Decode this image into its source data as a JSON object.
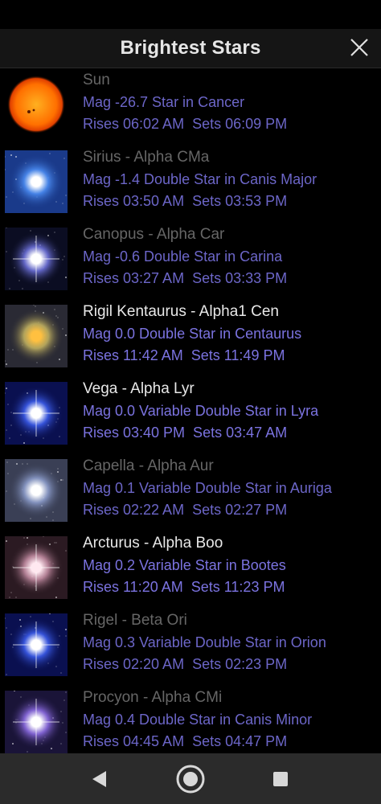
{
  "header": {
    "title": "Brightest Stars",
    "close_icon": "close-icon"
  },
  "stars": [
    {
      "name": "Sun",
      "mag_line": "Mag -26.7 Star in Cancer",
      "rise_line": "Rises 06:02 AM  Sets 06:09 PM",
      "above_horizon": false,
      "image": "sun"
    },
    {
      "name": "Sirius - Alpha CMa",
      "mag_line": "Mag -1.4 Double Star in Canis Major",
      "rise_line": "Rises 03:50 AM  Sets 03:53 PM",
      "above_horizon": false,
      "image": "blue-white-star"
    },
    {
      "name": "Canopus - Alpha Car",
      "mag_line": "Mag -0.6 Double Star in Carina",
      "rise_line": "Rises 03:27 AM  Sets 03:33 PM",
      "above_horizon": false,
      "image": "white-star"
    },
    {
      "name": "Rigil Kentaurus - Alpha1 Cen",
      "mag_line": "Mag 0.0 Double Star in Centaurus",
      "rise_line": "Rises 11:42 AM  Sets 11:49 PM",
      "above_horizon": true,
      "image": "yellow-star"
    },
    {
      "name": "Vega - Alpha Lyr",
      "mag_line": "Mag 0.0 Variable Double Star in Lyra",
      "rise_line": "Rises 03:40 PM  Sets 03:47 AM",
      "above_horizon": true,
      "image": "blue-star"
    },
    {
      "name": "Capella - Alpha Aur",
      "mag_line": "Mag 0.1 Variable Double Star in Auriga",
      "rise_line": "Rises 02:22 AM  Sets 02:27 PM",
      "above_horizon": false,
      "image": "pale-star"
    },
    {
      "name": "Arcturus - Alpha Boo",
      "mag_line": "Mag 0.2 Variable Star in Bootes",
      "rise_line": "Rises 11:20 AM  Sets 11:23 PM",
      "above_horizon": true,
      "image": "pink-star"
    },
    {
      "name": "Rigel - Beta Ori",
      "mag_line": "Mag 0.3 Variable Double Star in Orion",
      "rise_line": "Rises 02:20 AM  Sets 02:23 PM",
      "above_horizon": false,
      "image": "blue-star"
    },
    {
      "name": "Procyon - Alpha CMi",
      "mag_line": "Mag 0.4 Double Star in Canis Minor",
      "rise_line": "Rises 04:45 AM  Sets 04:47 PM",
      "above_horizon": false,
      "image": "violet-star"
    }
  ],
  "navbar": {
    "back_icon": "back-triangle-icon",
    "home_icon": "home-circle-icon",
    "recents_icon": "recents-square-icon"
  },
  "colors": {
    "header_bg": "#151515",
    "accent_text": "#7b73e0",
    "name_bright": "#e8e8e8",
    "name_dim": "#666666",
    "navbar_bg": "#2b2b2b"
  }
}
